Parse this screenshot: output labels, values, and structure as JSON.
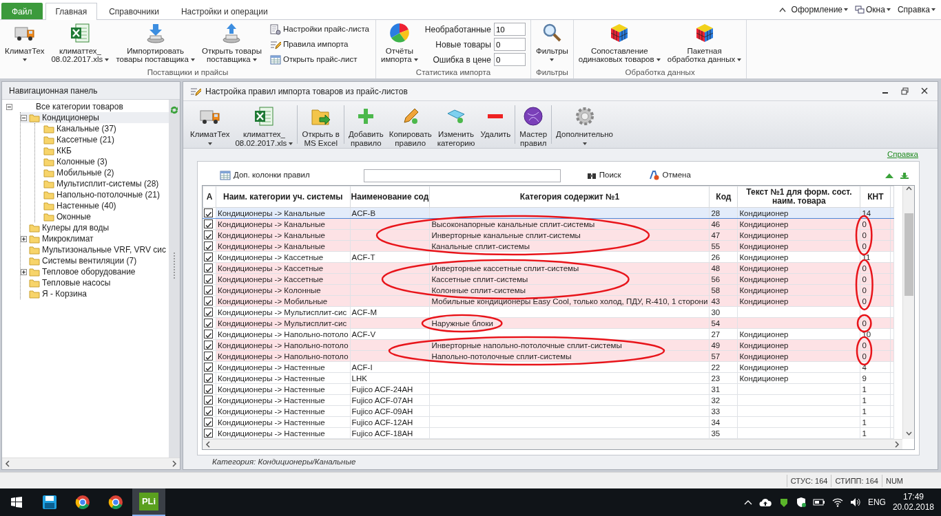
{
  "menu_tabs": [
    {
      "label": "Файл",
      "kind": "file",
      "selected": false
    },
    {
      "label": "Главная",
      "kind": "tab",
      "selected": true
    },
    {
      "label": "Справочники",
      "kind": "tab",
      "selected": false
    },
    {
      "label": "Настройки и операции",
      "kind": "tab",
      "selected": false
    }
  ],
  "menu_right": [
    {
      "label": "Оформление",
      "dropdown": true
    },
    {
      "label": "Окна",
      "dropdown": true
    },
    {
      "label": "Справка",
      "dropdown": true
    }
  ],
  "ribbon": {
    "groups": [
      {
        "label": "Поставщики и прайсы",
        "items": [
          {
            "kind": "large",
            "lines": [
              "КлиматТех"
            ],
            "dropdown": true
          },
          {
            "kind": "large",
            "lines": [
              "климаттех_",
              "08.02.2017.xls"
            ],
            "dropdown": true
          },
          {
            "kind": "large",
            "lines": [
              "Импортировать",
              "товары поставщика"
            ],
            "dropdown": true
          },
          {
            "kind": "large",
            "lines": [
              "Открыть товары",
              "поставщика"
            ],
            "dropdown": true
          },
          {
            "kind": "small",
            "label": "Настройки прайс-листа"
          },
          {
            "kind": "small",
            "label": "Правила импорта"
          },
          {
            "kind": "small",
            "label": "Открыть прайс-лист"
          }
        ]
      },
      {
        "label": "Статистика импорта",
        "items": [
          {
            "kind": "large",
            "lines": [
              "Отчёты",
              "импорта"
            ],
            "dropdown": true
          },
          {
            "kind": "field",
            "label": "Необработанные",
            "value": "10"
          },
          {
            "kind": "field",
            "label": "Новые товары",
            "value": "0"
          },
          {
            "kind": "field",
            "label": "Ошибка в цене",
            "value": "0"
          }
        ]
      },
      {
        "label": "Фильтры",
        "items": [
          {
            "kind": "large",
            "lines": [
              "Фильтры"
            ],
            "dropdown": true
          }
        ]
      },
      {
        "label": "Обработка данных",
        "items": [
          {
            "kind": "large",
            "lines": [
              "Сопоставление",
              "одинаковых товаров"
            ],
            "dropdown": true
          },
          {
            "kind": "large",
            "lines": [
              "Пакетная",
              "обработка данных"
            ],
            "dropdown": true
          }
        ]
      }
    ]
  },
  "nav": {
    "title": "Навигационная панель",
    "tree": [
      {
        "label": "Все категории товаров",
        "expanded": true,
        "selected": false,
        "children": [
          {
            "label": "Кондиционеры",
            "expanded": true,
            "selected": true,
            "children": [
              {
                "label": "Канальные (37)",
                "selected": false
              },
              {
                "label": "Кассетные (21)",
                "selected": false
              },
              {
                "label": "ККБ",
                "selected": false
              },
              {
                "label": "Колонные (3)",
                "selected": false
              },
              {
                "label": "Мобильные (2)",
                "selected": false
              },
              {
                "label": "Мультисплит-системы (28)",
                "selected": false
              },
              {
                "label": "Напольно-потолочные (21)",
                "selected": false
              },
              {
                "label": "Настенные (40)",
                "selected": false
              },
              {
                "label": "Оконные",
                "selected": false
              }
            ]
          },
          {
            "label": "Кулеры для воды",
            "selected": false
          },
          {
            "label": "Микроклимат",
            "expanded": false,
            "selected": false
          },
          {
            "label": "Мультизональные VRF, VRV сис",
            "selected": false
          },
          {
            "label": "Системы вентиляции (7)",
            "selected": false
          },
          {
            "label": "Тепловое оборудование",
            "expanded": false,
            "selected": false
          },
          {
            "label": "Тепловые насосы",
            "selected": false
          },
          {
            "label": "Я - Корзина",
            "selected": false
          }
        ]
      }
    ]
  },
  "window": {
    "title": "Настройка правил импорта товаров из прайс-листов",
    "toolbar": [
      {
        "lines": [
          "КлиматТех"
        ],
        "dropdown": true
      },
      {
        "lines": [
          "климаттех_",
          "08.02.2017.xls"
        ],
        "dropdown": true,
        "divider_after": true
      },
      {
        "lines": [
          "Открыть в",
          "MS Excel"
        ],
        "divider_after": true
      },
      {
        "lines": [
          "Добавить",
          "правило"
        ]
      },
      {
        "lines": [
          "Копировать",
          "правило"
        ]
      },
      {
        "lines": [
          "Изменить",
          "категорию"
        ]
      },
      {
        "lines": [
          "Удалить"
        ],
        "divider_after": true
      },
      {
        "lines": [
          "Мастер",
          "правил"
        ],
        "divider_after": true
      },
      {
        "lines": [
          "Дополнительно"
        ],
        "dropdown": true
      }
    ],
    "help_link": "Справка",
    "filter_bar": {
      "columns_button": "Доп. колонки правил",
      "search_button": "Поиск",
      "cancel_button": "Отмена"
    },
    "table": {
      "columns": [
        {
          "lines": [
            "А"
          ]
        },
        {
          "lines": [
            "Наим. категории уч. системы"
          ]
        },
        {
          "lines": [
            "Наименование сод"
          ]
        },
        {
          "lines": [
            "Категория содержит №1"
          ]
        },
        {
          "lines": [
            "Код"
          ]
        },
        {
          "lines": [
            "Текст №1 для форм. сост.",
            "наим. товара"
          ]
        },
        {
          "lines": [
            "КНТ"
          ]
        }
      ],
      "rows": [
        {
          "checked": true,
          "selected": true,
          "unmatched": false,
          "category": "Кондиционеры -> Канальные",
          "name": "ACF-B",
          "code": "28",
          "text1": "Кондиционер",
          "knt": "14"
        },
        {
          "checked": true,
          "selected": false,
          "unmatched": true,
          "category": "Кондиционеры -> Канальные",
          "contains": "Высоконапорные канальные сплит-системы",
          "code": "46",
          "text1": "Кондиционер",
          "knt": "0",
          "circled_contains": true,
          "circled_knt": true
        },
        {
          "checked": true,
          "selected": false,
          "unmatched": true,
          "category": "Кондиционеры -> Канальные",
          "contains": "Инверторные канальные сплит-системы",
          "code": "47",
          "text1": "Кондиционер",
          "knt": "0",
          "circled_contains": true,
          "circled_knt": true
        },
        {
          "checked": true,
          "selected": false,
          "unmatched": true,
          "category": "Кондиционеры -> Канальные",
          "contains": "Канальные сплит-системы",
          "code": "55",
          "text1": "Кондиционер",
          "knt": "0",
          "circled_contains": true,
          "circled_knt": true
        },
        {
          "checked": true,
          "selected": false,
          "unmatched": false,
          "category": "Кондиционеры -> Кассетные",
          "name": "ACF-T",
          "code": "26",
          "text1": "Кондиционер",
          "knt": "11"
        },
        {
          "checked": true,
          "selected": false,
          "unmatched": true,
          "category": "Кондиционеры -> Кассетные",
          "contains": "Инверторные кассетные сплит-системы",
          "code": "48",
          "text1": "Кондиционер",
          "knt": "0",
          "circled_contains": true,
          "circled_knt": true
        },
        {
          "checked": true,
          "selected": false,
          "unmatched": true,
          "category": "Кондиционеры -> Кассетные",
          "contains": "Кассетные сплит-системы",
          "code": "56",
          "text1": "Кондиционер",
          "knt": "0",
          "circled_contains": true,
          "circled_knt": true
        },
        {
          "checked": true,
          "selected": false,
          "unmatched": true,
          "category": "Кондиционеры -> Колонные",
          "contains": "Колонные сплит-системы",
          "code": "58",
          "text1": "Кондиционер",
          "knt": "0",
          "circled_contains": true,
          "circled_knt": true
        },
        {
          "checked": true,
          "selected": false,
          "unmatched": true,
          "category": "Кондиционеры -> Мобильные",
          "contains": "Мобильные кондиционеры Easy Cool, только холод, ПДУ, R-410, 1 сторони",
          "code": "43",
          "text1": "Кондиционер",
          "knt": "0",
          "circled_knt": true
        },
        {
          "checked": true,
          "selected": false,
          "unmatched": false,
          "category": "Кондиционеры -> Мультисплит-сис",
          "name": "ACF-M",
          "code": "30"
        },
        {
          "checked": true,
          "selected": false,
          "unmatched": true,
          "category": "Кондиционеры -> Мультисплит-сис",
          "contains": "Наружные блоки",
          "code": "54",
          "knt": "0",
          "circled_contains": true,
          "circled_knt": true
        },
        {
          "checked": true,
          "selected": false,
          "unmatched": false,
          "category": "Кондиционеры -> Напольно-потоло",
          "name": "ACF-V",
          "code": "27",
          "text1": "Кондиционер",
          "knt": "10"
        },
        {
          "checked": true,
          "selected": false,
          "unmatched": true,
          "category": "Кондиционеры -> Напольно-потоло",
          "contains": "Инверторные напольно-потолочные сплит-системы",
          "code": "49",
          "text1": "Кондиционер",
          "knt": "0",
          "circled_contains": true,
          "circled_knt": true
        },
        {
          "checked": true,
          "selected": false,
          "unmatched": true,
          "category": "Кондиционеры -> Напольно-потоло",
          "contains": "Напольно-потолочные сплит-системы",
          "code": "57",
          "text1": "Кондиционер",
          "knt": "0",
          "circled_contains": true,
          "circled_knt": true
        },
        {
          "checked": true,
          "selected": false,
          "unmatched": false,
          "category": "Кондиционеры -> Настенные",
          "name": "ACF-I",
          "code": "22",
          "text1": "Кондиционер",
          "knt": "4"
        },
        {
          "checked": true,
          "selected": false,
          "unmatched": false,
          "category": "Кондиционеры -> Настенные",
          "name": "LHK",
          "code": "23",
          "text1": "Кондиционер",
          "knt": "9"
        },
        {
          "checked": true,
          "selected": false,
          "unmatched": false,
          "category": "Кондиционеры -> Настенные",
          "name": "Fujico ACF-24AH",
          "code": "31",
          "knt": "1"
        },
        {
          "checked": true,
          "selected": false,
          "unmatched": false,
          "category": "Кондиционеры -> Настенные",
          "name": "Fujico ACF-07AH",
          "code": "32",
          "knt": "1"
        },
        {
          "checked": true,
          "selected": false,
          "unmatched": false,
          "category": "Кондиционеры -> Настенные",
          "name": "Fujico ACF-09AH",
          "code": "33",
          "knt": "1"
        },
        {
          "checked": true,
          "selected": false,
          "unmatched": false,
          "category": "Кондиционеры -> Настенные",
          "name": "Fujico ACF-12AH",
          "code": "34",
          "knt": "1"
        },
        {
          "checked": true,
          "selected": false,
          "unmatched": false,
          "category": "Кондиционеры -> Настенные",
          "name": "Fujico ACF-18AH",
          "code": "35",
          "knt": "1"
        }
      ]
    },
    "footer": "Категория: Кондиционеры/Канальные"
  },
  "status_bar": [
    "СТУС: 164",
    "СТИПП: 164",
    "NUM"
  ],
  "taskbar": {
    "apps": [
      {
        "kind": "start",
        "selected": false
      },
      {
        "kind": "disk",
        "selected": false
      },
      {
        "kind": "browser",
        "selected": false
      },
      {
        "kind": "browser",
        "selected": false
      },
      {
        "kind": "pli",
        "label": "PLi",
        "selected": true
      }
    ],
    "lang": "ENG",
    "time": "17:49",
    "date": "20.02.2018"
  }
}
